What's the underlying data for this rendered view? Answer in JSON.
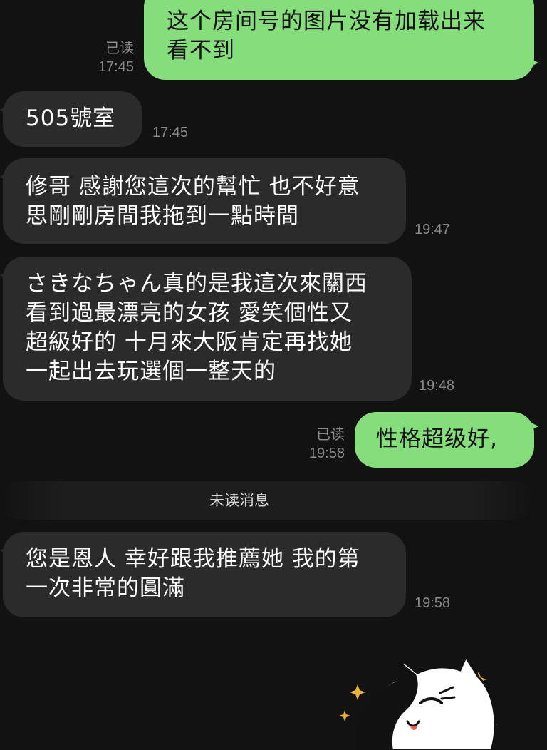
{
  "messages": [
    {
      "direction": "out",
      "text": "这个房间号的图片没有加载出来\n看不到",
      "read_status": "已读",
      "time": "17:45"
    },
    {
      "direction": "in",
      "text": "505號室",
      "time": "17:45"
    },
    {
      "direction": "in",
      "text": "修哥 感謝您這次的幫忙 也不好意\n思剛剛房間我拖到一點時間",
      "time": "19:47"
    },
    {
      "direction": "in",
      "text": "さきなちゃん真的是我這次來關西\n看到過最漂亮的女孩 愛笑個性又\n超級好的 十月來大阪肯定再找她\n一起出去玩選個一整天的",
      "time": "19:48"
    },
    {
      "direction": "out",
      "text": "性格超级好,",
      "read_status": "已读",
      "time": "19:58"
    },
    {
      "direction": "in",
      "text": "您是恩人 幸好跟我推薦她 我的第\n一次非常的圓滿",
      "time": "19:58"
    }
  ],
  "unread_divider": "未读消息",
  "sticker": {
    "icon": "cat-sticker-icon",
    "colors": {
      "body": "#ffffff",
      "patch": "#111111",
      "sparkle": "#e8b43a",
      "tongue": "#e85a4f"
    }
  },
  "colors": {
    "background": "#121212",
    "incoming_bubble": "#2b2b2b",
    "outgoing_bubble": "#85dd7b",
    "meta_text": "#8a8a8a"
  }
}
